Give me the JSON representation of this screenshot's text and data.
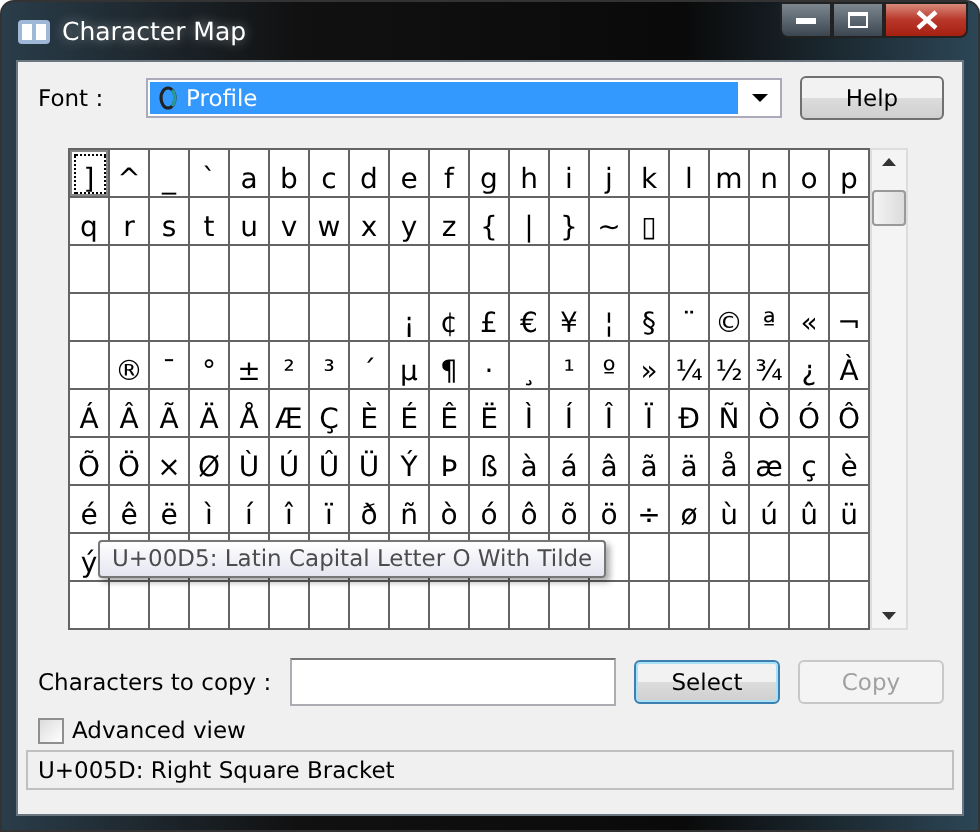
{
  "window": {
    "title": "Character Map"
  },
  "font": {
    "label": "Font :",
    "value": "Profile"
  },
  "help_button": "Help",
  "grid": {
    "rows": [
      [
        {
          "char": "]",
          "selected": true
        },
        {
          "char": "^",
          "selected": false
        },
        {
          "char": "_",
          "selected": false
        },
        {
          "char": "`",
          "selected": false
        },
        {
          "char": "a",
          "selected": false
        },
        {
          "char": "b",
          "selected": false
        },
        {
          "char": "c",
          "selected": false
        },
        {
          "char": "d",
          "selected": false
        },
        {
          "char": "e",
          "selected": false
        },
        {
          "char": "f",
          "selected": false
        },
        {
          "char": "g",
          "selected": false
        },
        {
          "char": "h",
          "selected": false
        },
        {
          "char": "i",
          "selected": false
        },
        {
          "char": "j",
          "selected": false
        },
        {
          "char": "k",
          "selected": false
        },
        {
          "char": "l",
          "selected": false
        },
        {
          "char": "m",
          "selected": false
        },
        {
          "char": "n",
          "selected": false
        },
        {
          "char": "o",
          "selected": false
        },
        {
          "char": "p",
          "selected": false
        }
      ],
      [
        {
          "char": "q",
          "selected": false
        },
        {
          "char": "r",
          "selected": false
        },
        {
          "char": "s",
          "selected": false
        },
        {
          "char": "t",
          "selected": false
        },
        {
          "char": "u",
          "selected": false
        },
        {
          "char": "v",
          "selected": false
        },
        {
          "char": "w",
          "selected": false
        },
        {
          "char": "x",
          "selected": false
        },
        {
          "char": "y",
          "selected": false
        },
        {
          "char": "z",
          "selected": false
        },
        {
          "char": "{",
          "selected": false
        },
        {
          "char": "|",
          "selected": false
        },
        {
          "char": "}",
          "selected": false
        },
        {
          "char": "~",
          "selected": false
        },
        {
          "char": "▯",
          "selected": false
        },
        {
          "selected": false
        },
        {
          "selected": false
        },
        {
          "selected": false
        },
        {
          "selected": false
        },
        {
          "selected": false
        }
      ],
      [
        {
          "selected": false
        },
        {
          "selected": false
        },
        {
          "selected": false
        },
        {
          "selected": false
        },
        {
          "selected": false
        },
        {
          "selected": false
        },
        {
          "selected": false
        },
        {
          "selected": false
        },
        {
          "selected": false
        },
        {
          "selected": false
        },
        {
          "selected": false
        },
        {
          "selected": false
        },
        {
          "selected": false
        },
        {
          "selected": false
        },
        {
          "selected": false
        },
        {
          "selected": false
        },
        {
          "selected": false
        },
        {
          "selected": false
        },
        {
          "selected": false
        },
        {
          "selected": false
        }
      ],
      [
        {
          "selected": false
        },
        {
          "selected": false
        },
        {
          "selected": false
        },
        {
          "selected": false
        },
        {
          "selected": false
        },
        {
          "selected": false
        },
        {
          "selected": false
        },
        {
          "selected": false
        },
        {
          "char": "¡",
          "selected": false
        },
        {
          "char": "¢",
          "selected": false
        },
        {
          "char": "£",
          "selected": false
        },
        {
          "char": "€",
          "selected": false
        },
        {
          "char": "¥",
          "selected": false
        },
        {
          "char": "¦",
          "selected": false
        },
        {
          "char": "§",
          "selected": false
        },
        {
          "char": "¨",
          "selected": false
        },
        {
          "char": "©",
          "selected": false
        },
        {
          "char": "ª",
          "selected": false
        },
        {
          "char": "«",
          "selected": false
        },
        {
          "char": "¬",
          "selected": false
        }
      ],
      [
        {
          "selected": false
        },
        {
          "char": "®",
          "selected": false
        },
        {
          "char": "¯",
          "selected": false
        },
        {
          "char": "°",
          "selected": false
        },
        {
          "char": "±",
          "selected": false
        },
        {
          "char": "²",
          "selected": false
        },
        {
          "char": "³",
          "selected": false
        },
        {
          "char": "´",
          "selected": false
        },
        {
          "char": "µ",
          "selected": false
        },
        {
          "char": "¶",
          "selected": false
        },
        {
          "char": "·",
          "selected": false
        },
        {
          "char": "¸",
          "selected": false
        },
        {
          "char": "¹",
          "selected": false
        },
        {
          "char": "º",
          "selected": false
        },
        {
          "char": "»",
          "selected": false
        },
        {
          "char": "¼",
          "selected": false
        },
        {
          "char": "½",
          "selected": false
        },
        {
          "char": "¾",
          "selected": false
        },
        {
          "char": "¿",
          "selected": false
        },
        {
          "char": "À",
          "selected": false
        }
      ],
      [
        {
          "char": "Á",
          "selected": false
        },
        {
          "char": "Â",
          "selected": false
        },
        {
          "char": "Ã",
          "selected": false
        },
        {
          "char": "Ä",
          "selected": false
        },
        {
          "char": "Å",
          "selected": false
        },
        {
          "char": "Æ",
          "selected": false
        },
        {
          "char": "Ç",
          "selected": false
        },
        {
          "char": "È",
          "selected": false
        },
        {
          "char": "É",
          "selected": false
        },
        {
          "char": "Ê",
          "selected": false
        },
        {
          "char": "Ë",
          "selected": false
        },
        {
          "char": "Ì",
          "selected": false
        },
        {
          "char": "Í",
          "selected": false
        },
        {
          "char": "Î",
          "selected": false
        },
        {
          "char": "Ï",
          "selected": false
        },
        {
          "char": "Ð",
          "selected": false
        },
        {
          "char": "Ñ",
          "selected": false
        },
        {
          "char": "Ò",
          "selected": false
        },
        {
          "char": "Ó",
          "selected": false
        },
        {
          "char": "Ô",
          "selected": false
        }
      ],
      [
        {
          "char": "Õ",
          "selected": false
        },
        {
          "char": "Ö",
          "selected": false
        },
        {
          "char": "×",
          "selected": false
        },
        {
          "char": "Ø",
          "selected": false
        },
        {
          "char": "Ù",
          "selected": false
        },
        {
          "char": "Ú",
          "selected": false
        },
        {
          "char": "Û",
          "selected": false
        },
        {
          "char": "Ü",
          "selected": false
        },
        {
          "char": "Ý",
          "selected": false
        },
        {
          "char": "Þ",
          "selected": false
        },
        {
          "char": "ß",
          "selected": false
        },
        {
          "char": "à",
          "selected": false
        },
        {
          "char": "á",
          "selected": false
        },
        {
          "char": "â",
          "selected": false
        },
        {
          "char": "ã",
          "selected": false
        },
        {
          "char": "ä",
          "selected": false
        },
        {
          "char": "å",
          "selected": false
        },
        {
          "char": "æ",
          "selected": false
        },
        {
          "char": "ç",
          "selected": false
        },
        {
          "char": "è",
          "selected": false
        }
      ],
      [
        {
          "char": "é",
          "selected": false
        },
        {
          "char": "ê",
          "selected": false
        },
        {
          "char": "ë",
          "selected": false
        },
        {
          "char": "ì",
          "selected": false
        },
        {
          "char": "í",
          "selected": false
        },
        {
          "char": "î",
          "selected": false
        },
        {
          "char": "ï",
          "selected": false
        },
        {
          "char": "ð",
          "selected": false
        },
        {
          "char": "ñ",
          "selected": false
        },
        {
          "char": "ò",
          "selected": false
        },
        {
          "char": "ó",
          "selected": false
        },
        {
          "char": "ô",
          "selected": false
        },
        {
          "char": "õ",
          "selected": false
        },
        {
          "char": "ö",
          "selected": false
        },
        {
          "char": "÷",
          "selected": false
        },
        {
          "char": "ø",
          "selected": false
        },
        {
          "char": "ù",
          "selected": false
        },
        {
          "char": "ú",
          "selected": false
        },
        {
          "char": "û",
          "selected": false
        },
        {
          "char": "ü",
          "selected": false
        }
      ],
      [
        {
          "char": "ý",
          "selected": false
        },
        {
          "selected": false
        },
        {
          "selected": false
        },
        {
          "selected": false
        },
        {
          "selected": false
        },
        {
          "selected": false
        },
        {
          "selected": false
        },
        {
          "selected": false
        },
        {
          "selected": false
        },
        {
          "selected": false
        },
        {
          "selected": false
        },
        {
          "selected": false
        },
        {
          "selected": false
        },
        {
          "selected": false
        },
        {
          "selected": false
        },
        {
          "selected": false
        },
        {
          "selected": false
        },
        {
          "selected": false
        },
        {
          "selected": false
        },
        {
          "selected": false
        }
      ],
      [
        {
          "selected": false
        },
        {
          "selected": false
        },
        {
          "selected": false
        },
        {
          "selected": false
        },
        {
          "selected": false
        },
        {
          "selected": false
        },
        {
          "selected": false
        },
        {
          "selected": false
        },
        {
          "selected": false
        },
        {
          "selected": false
        },
        {
          "selected": false
        },
        {
          "selected": false
        },
        {
          "selected": false
        },
        {
          "selected": false
        },
        {
          "selected": false
        },
        {
          "selected": false
        },
        {
          "selected": false
        },
        {
          "selected": false
        },
        {
          "selected": false
        },
        {
          "selected": false
        }
      ]
    ]
  },
  "tooltip": "U+00D5: Latin Capital Letter O With Tilde",
  "copy_field": {
    "label": "Characters to copy :"
  },
  "select_button": "Select",
  "copy_button": {
    "label": "Copy",
    "disabled": true
  },
  "advanced_view": {
    "label": "Advanced view",
    "checked": false
  },
  "status_bar": "U+005D: Right Square Bracket"
}
